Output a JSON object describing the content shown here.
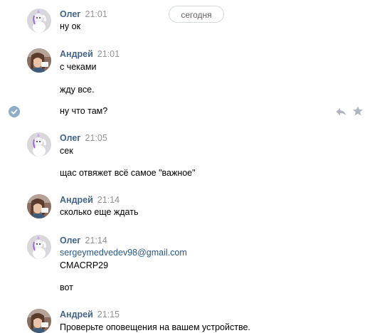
{
  "date_divider": "сегодня",
  "messages": [
    {
      "author": "Олег",
      "time": "21:01",
      "lines": [
        "ну ок"
      ]
    },
    {
      "author": "Андрей",
      "time": "21:01",
      "lines": [
        "с чеками",
        "жду все.",
        "ну что там?"
      ]
    },
    {
      "author": "Олег",
      "time": "21:05",
      "lines": [
        "сек",
        "щас отвяжет всё самое \"важное\""
      ]
    },
    {
      "author": "Андрей",
      "time": "21:14",
      "lines": [
        "сколько еще ждать"
      ]
    },
    {
      "author": "Олег",
      "time": "21:14",
      "link": "sergeymedvedev98@gmail.com",
      "lines": [
        "CMACRP29",
        "вот"
      ]
    },
    {
      "author": "Андрей",
      "time": "21:15",
      "lines": [
        "Проверьте оповещения на вашем устройстве."
      ]
    }
  ],
  "icons": {
    "selected": "check-circle-icon",
    "reply": "reply-icon",
    "favorite": "star-icon"
  },
  "colors": {
    "author": "#42648b",
    "link": "#2a5885",
    "check": "#8fadc8",
    "action": "#aeb7c2"
  }
}
